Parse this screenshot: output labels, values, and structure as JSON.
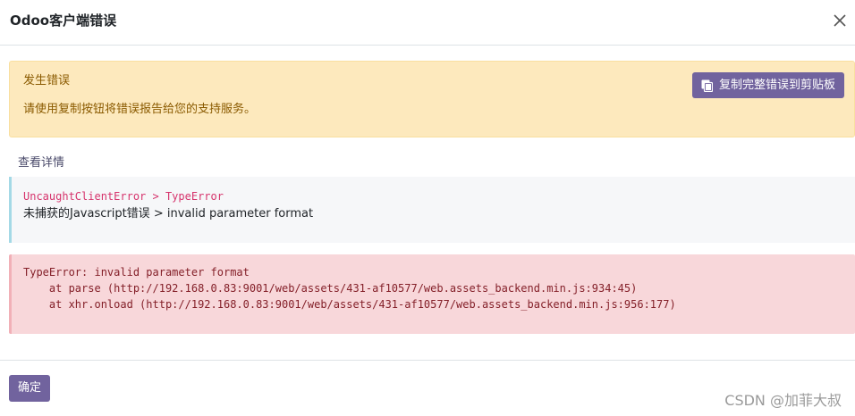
{
  "dialog": {
    "title": "Odoo客户端错误",
    "close_icon": "close-icon"
  },
  "alert": {
    "title": "发生错误",
    "message": "请使用复制按钮将错误报告给您的支持服务。",
    "copy_button_label": "复制完整错误到剪贴板",
    "copy_icon": "clipboard-icon"
  },
  "details": {
    "link_label": "查看详情"
  },
  "info": {
    "error_type": "UncaughtClientError > TypeError",
    "error_summary": "未捕获的Javascript错误 > invalid parameter format"
  },
  "traceback": {
    "lines": [
      "TypeError: invalid parameter format",
      "    at parse (http://192.168.0.83:9001/web/assets/431-af10577/web.assets_backend.min.js:934:45)",
      "    at xhr.onload (http://192.168.0.83:9001/web/assets/431-af10577/web.assets_backend.min.js:956:177)"
    ]
  },
  "footer": {
    "ok_label": "确定",
    "watermark": "CSDN @加菲大叔"
  },
  "colors": {
    "primary": "#71639e",
    "warning_bg": "#fde9bd",
    "danger_bg": "#f8d7da",
    "info_border": "#a4d9e6"
  }
}
